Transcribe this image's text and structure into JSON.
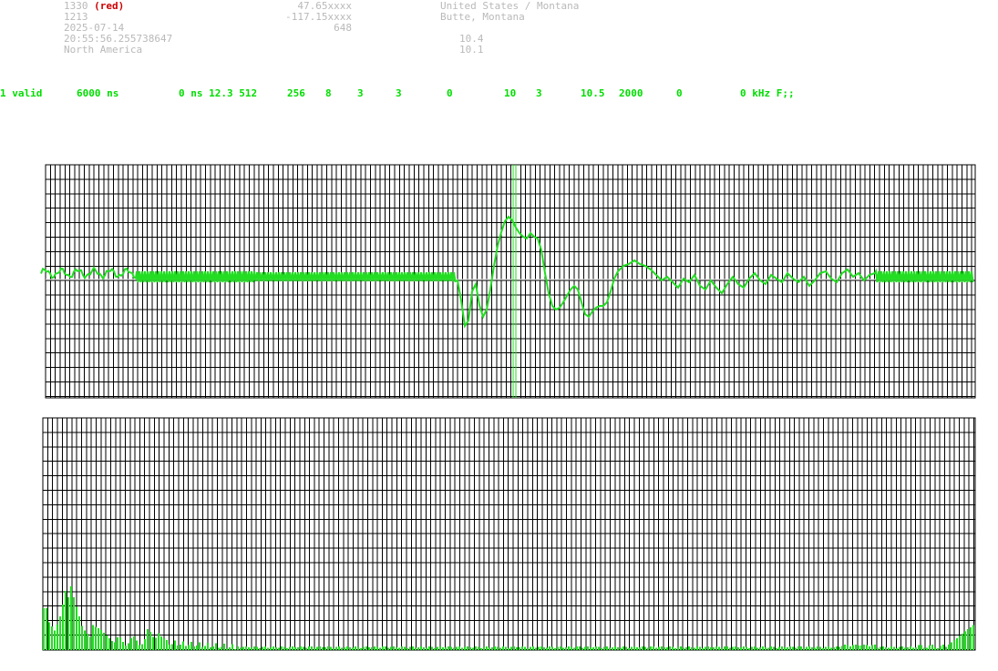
{
  "header": {
    "station_id": "1330",
    "station_tag": "(red)",
    "station_number": "1213",
    "date": "2025-07-14",
    "time": "20:55:56.255738647",
    "continent": "North America",
    "latitude": "47.65xxxx",
    "longitude": "-117.15xxxx",
    "altitude": "648",
    "country_region": "United States / Montana",
    "city": "Butte, Montana",
    "value_a": "10.4",
    "value_b": "10.1"
  },
  "params": {
    "status": "1 valid",
    "duration": "6000 ns",
    "rest": "0 ns 12.3 512",
    "p256": "256",
    "p8": "8",
    "p3a": "3",
    "p3b": "3",
    "p0a": "0",
    "p10": "10",
    "p3c": "3",
    "p105": "10.5",
    "p2000": "2000",
    "p0b": "0",
    "tail": "0 kHz F;;"
  },
  "colors": {
    "signal": "#22dd22",
    "grid": "#000000",
    "meta_text": "#b9b9b9",
    "tag": "#cc0000",
    "params_text": "#00dd00"
  }
}
